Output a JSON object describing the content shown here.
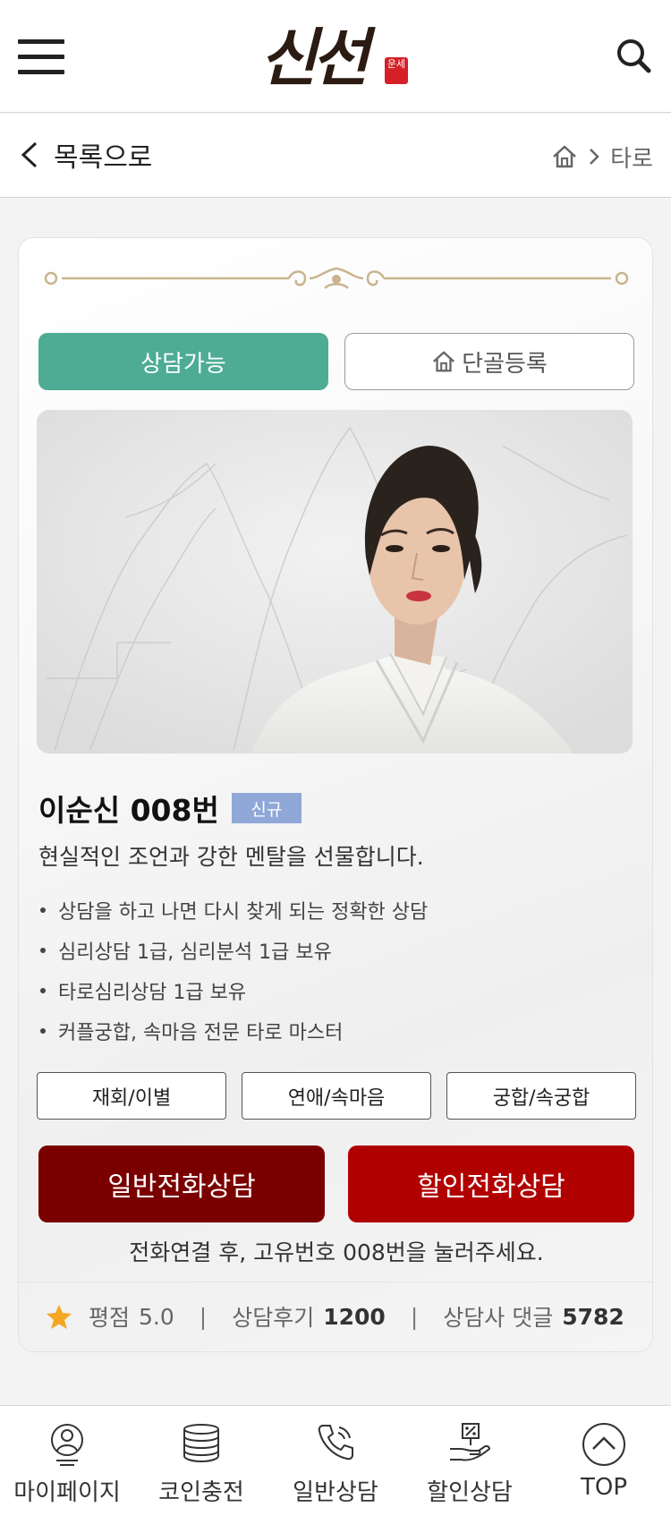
{
  "header": {
    "logo_text": "신선",
    "logo_seal": "운세"
  },
  "subnav": {
    "back_label": "목록으로",
    "breadcrumb_current": "타로"
  },
  "card": {
    "status_label": "상담가능",
    "favorite_label": "단골등록",
    "name": "이순신 008번",
    "badge": "신규",
    "tagline": "현실적인 조언과 강한 멘탈을 선물합니다.",
    "bullets": [
      "상담을 하고 나면 다시 찾게 되는 정확한 상담",
      "심리상담 1급, 심리분석 1급 보유",
      "타로심리상담 1급 보유",
      "커플궁합, 속마음 전문 타로 마스터"
    ],
    "tags": [
      "재회/이별",
      "연애/속마음",
      "궁합/속궁합"
    ],
    "call_normal_label": "일반전화상담",
    "call_discount_label": "할인전화상담",
    "call_note": "전화연결 후, 고유번호 008번을 눌러주세요.",
    "stats": {
      "rating_label": "평점",
      "rating_value": "5.0",
      "reviews_label": "상담후기",
      "reviews_value": "1200",
      "comments_label": "상담사 댓글",
      "comments_value": "5782"
    }
  },
  "bottom_nav": [
    {
      "label": "마이페이지",
      "icon": "user-icon"
    },
    {
      "label": "코인충전",
      "icon": "coins-icon"
    },
    {
      "label": "일반상담",
      "icon": "phone-icon"
    },
    {
      "label": "할인상담",
      "icon": "discount-icon"
    },
    {
      "label": "TOP",
      "icon": "arrow-up-circle-icon"
    }
  ],
  "colors": {
    "status_green": "#4dac93",
    "call_normal": "#7a0000",
    "call_discount": "#b10000",
    "badge_blue": "#8fa8d8",
    "star": "#f5a623"
  }
}
